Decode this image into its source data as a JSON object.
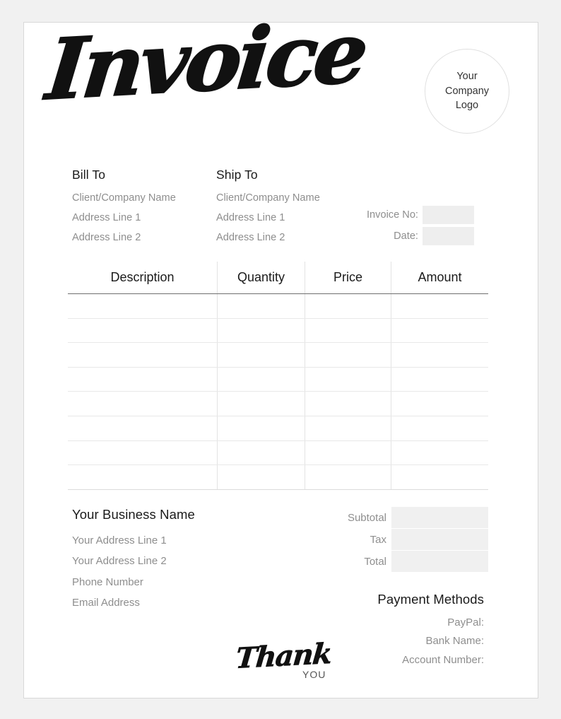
{
  "document": {
    "title": "Invoice"
  },
  "logo": {
    "lines": [
      "Your",
      "Company",
      "Logo"
    ]
  },
  "bill_to": {
    "heading": "Bill To",
    "lines": [
      "Client/Company Name",
      "Address Line 1",
      "Address Line 2"
    ]
  },
  "ship_to": {
    "heading": "Ship To",
    "lines": [
      "Client/Company Name",
      "Address Line 1",
      "Address Line 2"
    ]
  },
  "meta": {
    "invoice_no_label": "Invoice No:",
    "invoice_no_value": "",
    "date_label": "Date:",
    "date_value": ""
  },
  "items_table": {
    "columns": [
      "Description",
      "Quantity",
      "Price",
      "Amount"
    ],
    "row_count": 8,
    "rows": [
      {
        "description": "",
        "quantity": "",
        "price": "",
        "amount": ""
      },
      {
        "description": "",
        "quantity": "",
        "price": "",
        "amount": ""
      },
      {
        "description": "",
        "quantity": "",
        "price": "",
        "amount": ""
      },
      {
        "description": "",
        "quantity": "",
        "price": "",
        "amount": ""
      },
      {
        "description": "",
        "quantity": "",
        "price": "",
        "amount": ""
      },
      {
        "description": "",
        "quantity": "",
        "price": "",
        "amount": ""
      },
      {
        "description": "",
        "quantity": "",
        "price": "",
        "amount": ""
      },
      {
        "description": "",
        "quantity": "",
        "price": "",
        "amount": ""
      }
    ]
  },
  "business": {
    "name": "Your Business Name",
    "lines": [
      "Your Address Line 1",
      "Your Address Line 2",
      "Phone Number",
      "Email Address"
    ]
  },
  "totals": {
    "subtotal_label": "Subtotal",
    "subtotal_value": "",
    "tax_label": "Tax",
    "tax_value": "",
    "total_label": "Total",
    "total_value": ""
  },
  "payment": {
    "heading": "Payment Methods",
    "lines": [
      "PayPal:",
      "Bank Name:",
      "Account Number:"
    ]
  },
  "thank_you": {
    "script": "Thank",
    "sub": "YOU"
  },
  "colors": {
    "page_background": "#f1f1f1",
    "sheet": "#ffffff",
    "sheet_border": "#d8d8d8",
    "heading_text": "#1a1a1a",
    "body_text": "#8e8e8e",
    "field_fill": "#eeeeee",
    "total_fill": "#f0f0f0",
    "table_rule": "#6f6f6f",
    "table_line": "#e8e8e8"
  }
}
